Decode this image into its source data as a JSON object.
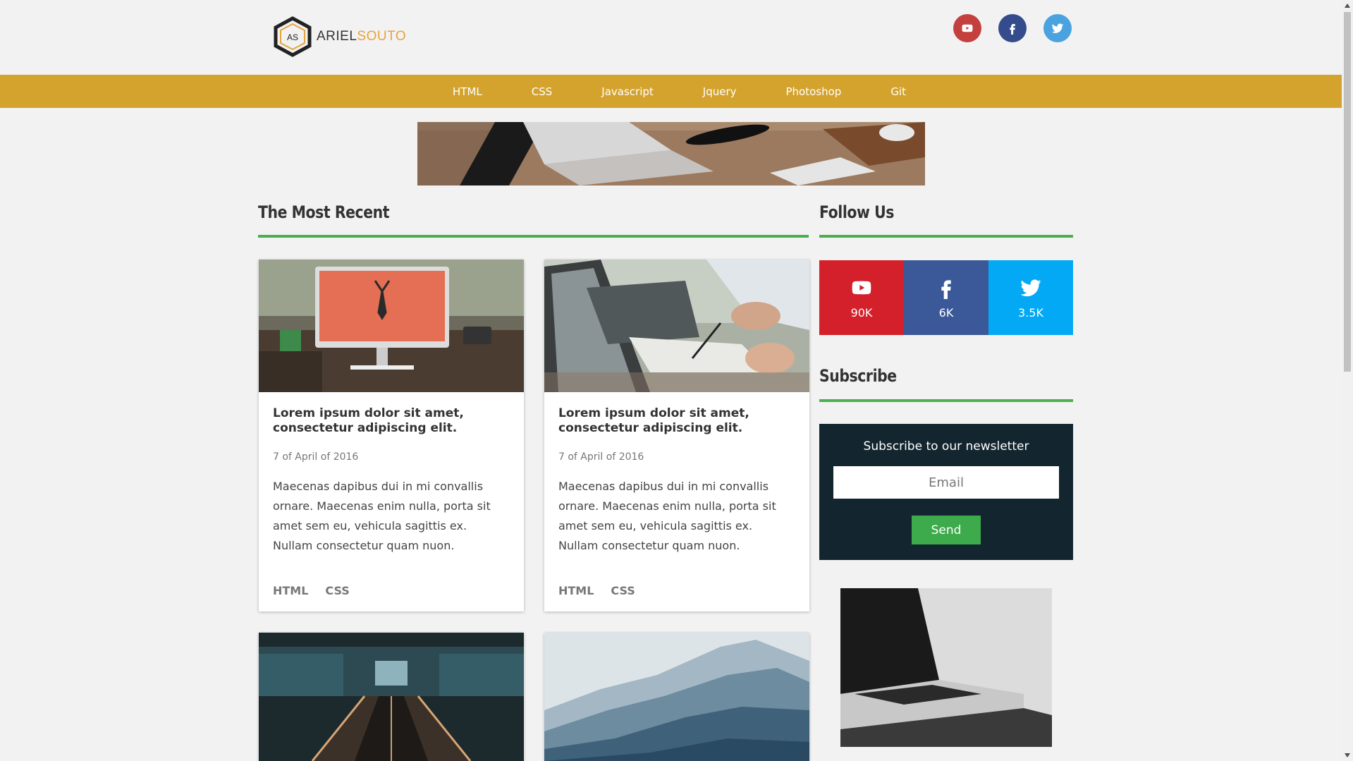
{
  "header": {
    "logo_initials": "AS",
    "logo_first": "ARIEL",
    "logo_last": "SOUTO",
    "social": [
      {
        "icon": "youtube-icon",
        "color": "#c4403f"
      },
      {
        "icon": "facebook-icon",
        "color": "#344b8c"
      },
      {
        "icon": "twitter-icon",
        "color": "#4aa3df"
      }
    ]
  },
  "nav": {
    "items": [
      "HTML",
      "CSS",
      "Javascript",
      "Jquery",
      "Photoshop",
      "Git"
    ]
  },
  "main": {
    "section_title": "The Most Recent",
    "cards": [
      {
        "title": "Lorem ipsum dolor sit amet, consectetur adipiscing elit.",
        "date": "7 of April of 2016",
        "text": "Maecenas dapibus dui in mi convallis ornare. Maecenas enim nulla, porta sit amet sem eu, vehicula sagittis ex. Nullam consectetur quam nuon.",
        "tags": [
          "HTML",
          "CSS"
        ]
      },
      {
        "title": "Lorem ipsum dolor sit amet, consectetur adipiscing elit.",
        "date": "7 of April of 2016",
        "text": "Maecenas dapibus dui in mi convallis ornare. Maecenas enim nulla, porta sit amet sem eu, vehicula sagittis ex. Nullam consectetur quam nuon.",
        "tags": [
          "HTML",
          "CSS"
        ]
      }
    ]
  },
  "sidebar": {
    "follow_title": "Follow Us",
    "follow": [
      {
        "icon": "youtube-icon",
        "count": "90K",
        "color": "#d4202a"
      },
      {
        "icon": "facebook-icon",
        "count": "6K",
        "color": "#3b5998"
      },
      {
        "icon": "twitter-icon",
        "count": "3.5K",
        "color": "#03a9f4"
      }
    ],
    "subscribe_title": "Subscribe",
    "subscribe_label": "Subscribe to our newsletter",
    "email_placeholder": "Email",
    "send_label": "Send"
  },
  "colors": {
    "nav_bg": "#d4a32e",
    "accent_line": "#4caf50",
    "subscribe_bg": "#13252f",
    "send_btn": "#3daa4b"
  }
}
